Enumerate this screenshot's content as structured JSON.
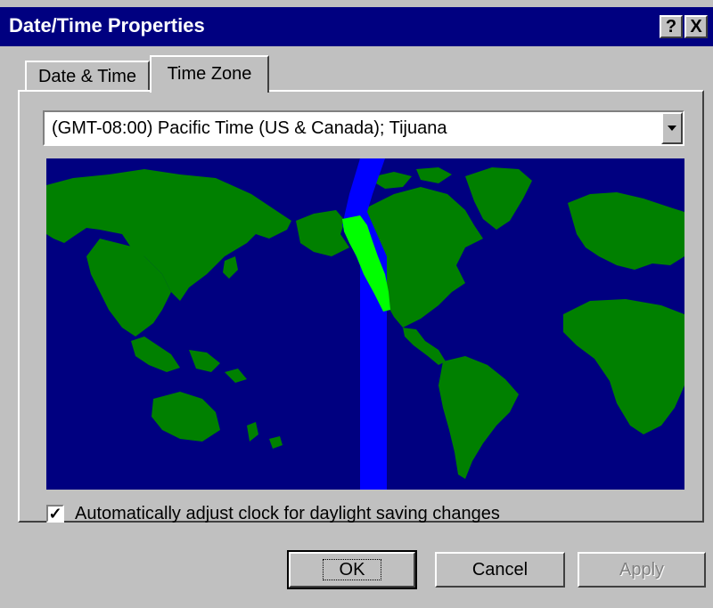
{
  "window": {
    "title": "Date/Time Properties"
  },
  "titlebar_buttons": {
    "help": "?",
    "close": "X"
  },
  "tabs": [
    {
      "label": "Date & Time"
    },
    {
      "label": "Time Zone"
    }
  ],
  "timezone": {
    "selected": "(GMT-08:00) Pacific Time (US & Canada); Tijuana"
  },
  "map": {
    "ocean_color": "#000080",
    "land_color": "#008000",
    "zone_band_color": "#0000ff",
    "zone_land_color": "#00ff00"
  },
  "dst": {
    "label": "Automatically adjust clock for daylight saving changes",
    "checked": "✓"
  },
  "buttons": {
    "ok": "OK",
    "cancel": "Cancel",
    "apply": "Apply"
  }
}
